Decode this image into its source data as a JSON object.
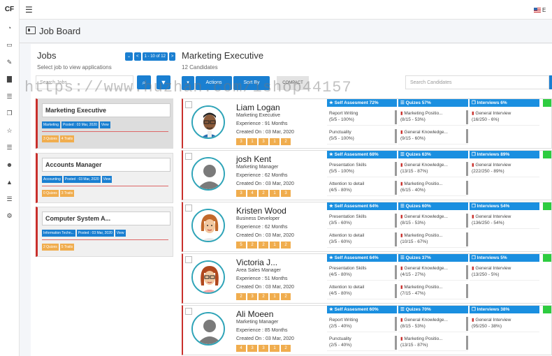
{
  "app": {
    "logo": "CF",
    "menu_icon": "hamburger-icon",
    "lang": "E"
  },
  "page": {
    "title": "Job Board"
  },
  "jobs": {
    "title": "Jobs",
    "subtitle": "Select job to view applications",
    "pager": {
      "prev": "<",
      "range": "1 - 10 of 12",
      "next": ">"
    },
    "search_placeholder": "Search Jobs",
    "items": [
      {
        "title": "Marketing Executive",
        "category": "Marketing",
        "posted": "Posted : 03 Mar, 2020",
        "view": "View",
        "quizzes": "3 Quizes",
        "traits": "4 Traits"
      },
      {
        "title": "Accounts Manager",
        "category": "Accounting",
        "posted": "Posted : 03 Mar, 2020",
        "view": "View",
        "quizzes": "0 Quizes",
        "traits": "3 Traits"
      },
      {
        "title": "Computer System A...",
        "category": "Information Techn...",
        "posted": "Posted : 03 Mar, 2020",
        "view": "View",
        "quizzes": "2 Quizes",
        "traits": "5 Traits"
      }
    ]
  },
  "candidates": {
    "title": "Marketing Executive",
    "subtitle": "12 Candidates",
    "actions_label": "Actions",
    "sort_label": "Sort By",
    "compact_label": "COMPACT",
    "search_placeholder": "Search Candidates",
    "rows": [
      {
        "name": "Liam Logan",
        "role": "Marketing Executive",
        "experience": "Experience : 91 Months",
        "created": "Created On : 03 Mar, 2020",
        "badges": [
          "3",
          "1",
          "3",
          "1",
          "2"
        ],
        "self": {
          "head": "Self Assesment 72%",
          "items": [
            {
              "t": "Report Writing",
              "v": "(5/5 - 100%)"
            },
            {
              "t": "Punctuality",
              "v": "(5/5 - 100%)"
            }
          ]
        },
        "quiz": {
          "head": "Quizes 57%",
          "items": [
            {
              "t": "Marketing Positio...",
              "v": "(8/15 - 53%)"
            },
            {
              "t": "General Knowledge...",
              "v": "(9/15 - 60%)"
            }
          ]
        },
        "interview": {
          "head": "Interviews 6%",
          "items": [
            {
              "t": "General Interview",
              "v": "(16/250 - 6%)"
            }
          ]
        }
      },
      {
        "name": "josh Kent",
        "role": "Marketing Manager",
        "experience": "Experience : 62 Months",
        "created": "Created On : 03 Mar, 2020",
        "badges": [
          "3",
          "4",
          "2",
          "1",
          "3"
        ],
        "self": {
          "head": "Self Assesment 68%",
          "items": [
            {
              "t": "Presentation Skills",
              "v": "(5/5 - 100%)"
            },
            {
              "t": "Attention to detail",
              "v": "(4/5 - 80%)"
            }
          ]
        },
        "quiz": {
          "head": "Quizes 63%",
          "items": [
            {
              "t": "General Knowledge...",
              "v": "(13/15 - 87%)"
            },
            {
              "t": "Marketing Positio...",
              "v": "(6/15 - 40%)"
            }
          ]
        },
        "interview": {
          "head": "Interviews 89%",
          "items": [
            {
              "t": "General Interview",
              "v": "(222/250 - 89%)"
            }
          ]
        }
      },
      {
        "name": "Kristen Wood",
        "role": "Business Developer",
        "experience": "Experience : 62 Months",
        "created": "Created On : 03 Mar, 2020",
        "badges": [
          "5",
          "2",
          "2",
          "1",
          "2"
        ],
        "self": {
          "head": "Self Assesment 64%",
          "items": [
            {
              "t": "Presentation Skills",
              "v": "(3/5 - 60%)"
            },
            {
              "t": "Attention to detail",
              "v": "(3/5 - 60%)"
            }
          ]
        },
        "quiz": {
          "head": "Quizes 60%",
          "items": [
            {
              "t": "General Knowledge...",
              "v": "(8/15 - 53%)"
            },
            {
              "t": "Marketing Positio...",
              "v": "(10/15 - 67%)"
            }
          ]
        },
        "interview": {
          "head": "Interviews 54%",
          "items": [
            {
              "t": "General Interview",
              "v": "(136/250 - 54%)"
            }
          ]
        }
      },
      {
        "name": "Victoria J...",
        "role": "Area Sales Manager",
        "experience": "Experience : 51 Months",
        "created": "Created On : 03 Mar, 2020",
        "badges": [
          "2",
          "3",
          "2",
          "1",
          "2"
        ],
        "self": {
          "head": "Self Assesment 64%",
          "items": [
            {
              "t": "Presentation Skills",
              "v": "(4/5 - 80%)"
            },
            {
              "t": "Attention to detail",
              "v": "(4/5 - 80%)"
            }
          ]
        },
        "quiz": {
          "head": "Quizes 37%",
          "items": [
            {
              "t": "General Knowledge...",
              "v": "(4/15 - 27%)"
            },
            {
              "t": "Marketing Positio...",
              "v": "(7/15 - 47%)"
            }
          ]
        },
        "interview": {
          "head": "Interviews 5%",
          "items": [
            {
              "t": "General Interview",
              "v": "(13/250 - 5%)"
            }
          ]
        }
      },
      {
        "name": "Ali Moeen",
        "role": "Marketing Manager",
        "experience": "Experience : 85 Months",
        "created": "Created On : 03 Mar, 2020",
        "badges": [
          "4",
          "3",
          "3",
          "1",
          "2"
        ],
        "self": {
          "head": "Self Assesment 60%",
          "items": [
            {
              "t": "Report Writing",
              "v": "(2/5 - 40%)"
            },
            {
              "t": "Punctuality",
              "v": "(2/5 - 40%)"
            }
          ]
        },
        "quiz": {
          "head": "Quizes 70%",
          "items": [
            {
              "t": "General Knowledge...",
              "v": "(8/15 - 53%)"
            },
            {
              "t": "Marketing Positio...",
              "v": "(13/15 - 87%)"
            }
          ]
        },
        "interview": {
          "head": "Interviews 38%",
          "items": [
            {
              "t": "General Interview",
              "v": "(95/250 - 38%)"
            }
          ]
        }
      }
    ]
  },
  "watermark": "https://www.huzhan.com/ishop44157"
}
